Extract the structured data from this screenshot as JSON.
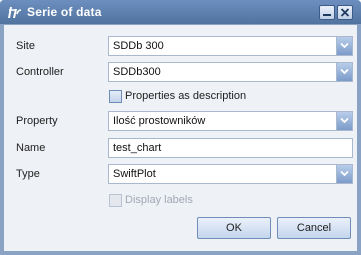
{
  "window": {
    "title": "Serie of data",
    "icon": "app-logo-icon"
  },
  "form": {
    "site": {
      "label": "Site",
      "value": "SDDb 300"
    },
    "controller": {
      "label": "Controller",
      "value": "SDDb300"
    },
    "properties_as_description": {
      "label": "Properties as description",
      "checked": false
    },
    "property": {
      "label": "Property",
      "value": "Ilość prostowników"
    },
    "name": {
      "label": "Name",
      "value": "test_chart"
    },
    "type": {
      "label": "Type",
      "value": "SwiftPlot"
    },
    "display_labels": {
      "label": "Display labels",
      "checked": false,
      "disabled": true
    }
  },
  "buttons": {
    "ok": "OK",
    "cancel": "Cancel"
  },
  "colors": {
    "titlebar": "#5f82b0",
    "client_bg": "#eef1f6",
    "accent": "#7b9bc9"
  }
}
